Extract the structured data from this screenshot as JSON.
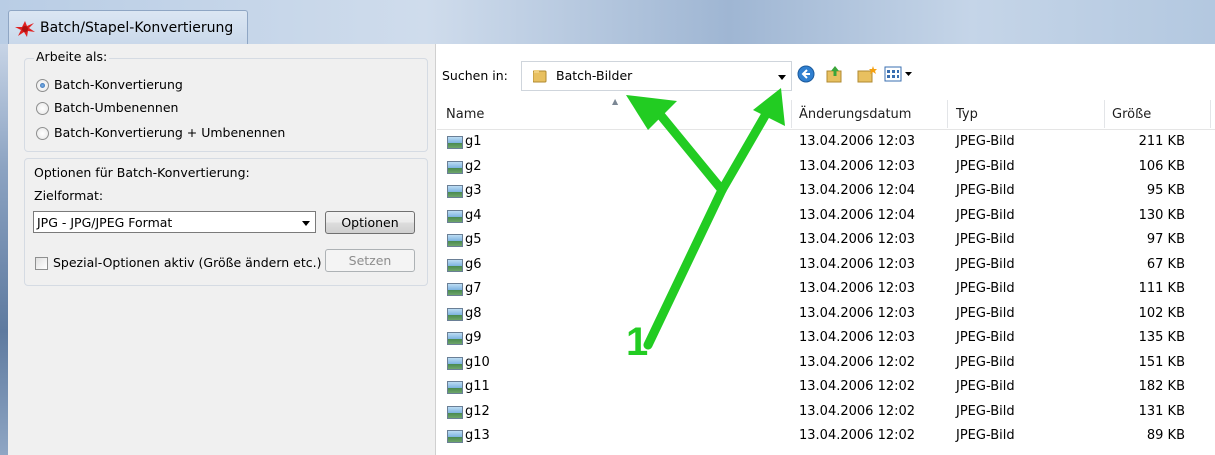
{
  "window": {
    "title": "Batch/Stapel-Konvertierung"
  },
  "mode_group": {
    "label": "Arbeite als:",
    "options": [
      {
        "label": "Batch-Konvertierung",
        "selected": true
      },
      {
        "label": "Batch-Umbenennen",
        "selected": false
      },
      {
        "label": "Batch-Konvertierung + Umbenennen",
        "selected": false
      }
    ]
  },
  "options_group": {
    "label": "Optionen für Batch-Konvertierung:",
    "target_label": "Zielformat:",
    "format_value": "JPG - JPG/JPEG Format",
    "options_button": "Optionen",
    "special_checkbox_label": "Spezial-Optionen aktiv (Größe ändern etc.)",
    "special_checked": false,
    "set_button": "Setzen"
  },
  "browser": {
    "search_in_label": "Suchen in:",
    "location": "Batch-Bilder",
    "toolbar_icons": [
      "back-icon",
      "up-folder-icon",
      "new-folder-icon",
      "view-menu-icon"
    ]
  },
  "table": {
    "headers": [
      "Name",
      "Änderungsdatum",
      "Typ",
      "Größe"
    ],
    "rows": [
      {
        "name": "g1",
        "date": "13.04.2006 12:03",
        "type": "JPEG-Bild",
        "size": "211 KB"
      },
      {
        "name": "g2",
        "date": "13.04.2006 12:03",
        "type": "JPEG-Bild",
        "size": "106 KB"
      },
      {
        "name": "g3",
        "date": "13.04.2006 12:04",
        "type": "JPEG-Bild",
        "size": "95 KB"
      },
      {
        "name": "g4",
        "date": "13.04.2006 12:04",
        "type": "JPEG-Bild",
        "size": "130 KB"
      },
      {
        "name": "g5",
        "date": "13.04.2006 12:03",
        "type": "JPEG-Bild",
        "size": "97 KB"
      },
      {
        "name": "g6",
        "date": "13.04.2006 12:03",
        "type": "JPEG-Bild",
        "size": "67 KB"
      },
      {
        "name": "g7",
        "date": "13.04.2006 12:03",
        "type": "JPEG-Bild",
        "size": "111 KB"
      },
      {
        "name": "g8",
        "date": "13.04.2006 12:03",
        "type": "JPEG-Bild",
        "size": "102 KB"
      },
      {
        "name": "g9",
        "date": "13.04.2006 12:03",
        "type": "JPEG-Bild",
        "size": "135 KB"
      },
      {
        "name": "g10",
        "date": "13.04.2006 12:02",
        "type": "JPEG-Bild",
        "size": "151 KB"
      },
      {
        "name": "g11",
        "date": "13.04.2006 12:02",
        "type": "JPEG-Bild",
        "size": "182 KB"
      },
      {
        "name": "g12",
        "date": "13.04.2006 12:02",
        "type": "JPEG-Bild",
        "size": "131 KB"
      },
      {
        "name": "g13",
        "date": "13.04.2006 12:02",
        "type": "JPEG-Bild",
        "size": "89 KB"
      }
    ]
  },
  "annotation": {
    "number": "1",
    "color": "#22cc22"
  }
}
